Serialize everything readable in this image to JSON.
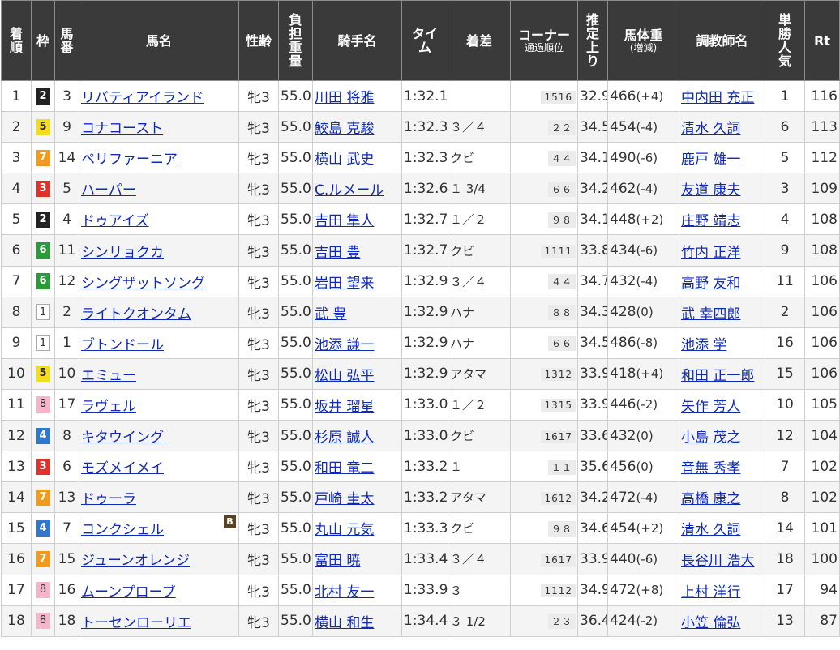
{
  "headers": {
    "rank": "着順",
    "waku": "枠",
    "num": "馬番",
    "horse": "馬名",
    "sexage": "性齢",
    "weight": "負担重量",
    "jockey": "騎手名",
    "time": "タイム",
    "margin": "着差",
    "corner_line1": "コーナー",
    "corner_line2": "通過順位",
    "last3f": "推定上り",
    "bodyweight_line1": "馬体重",
    "bodyweight_line2": "(増減)",
    "trainer": "調教師名",
    "pop": "単勝人気",
    "rt": "Rt"
  },
  "rows": [
    {
      "rank": "1",
      "waku": "2",
      "num": "3",
      "horse": "リバティアイランド",
      "blinker": "",
      "sexage": "牝3",
      "weight": "55.0",
      "jockey": "川田 将雅",
      "time": "1:32.1",
      "margin": "",
      "corner": "1516",
      "last3f": "32.9",
      "bw": "466",
      "bwdiff": "(+4)",
      "trainer": "中内田 充正",
      "pop": "1",
      "rt": "116"
    },
    {
      "rank": "2",
      "waku": "5",
      "num": "9",
      "horse": "コナコースト",
      "blinker": "",
      "sexage": "牝3",
      "weight": "55.0",
      "jockey": "鮫島 克駿",
      "time": "1:32.3",
      "margin": "３／４",
      "corner": "２２",
      "last3f": "34.5",
      "bw": "454",
      "bwdiff": "(-4)",
      "trainer": "清水 久詞",
      "pop": "6",
      "rt": "113"
    },
    {
      "rank": "3",
      "waku": "7",
      "num": "14",
      "horse": "ペリファーニア",
      "blinker": "",
      "sexage": "牝3",
      "weight": "55.0",
      "jockey": "横山 武史",
      "time": "1:32.3",
      "margin": "クビ",
      "corner": "４４",
      "last3f": "34.1",
      "bw": "490",
      "bwdiff": "(-6)",
      "trainer": "鹿戸 雄一",
      "pop": "5",
      "rt": "112"
    },
    {
      "rank": "4",
      "waku": "3",
      "num": "5",
      "horse": "ハーパー",
      "blinker": "",
      "sexage": "牝3",
      "weight": "55.0",
      "jockey": "C.ルメール",
      "time": "1:32.6",
      "margin": "１ 3/4",
      "corner": "６６",
      "last3f": "34.2",
      "bw": "462",
      "bwdiff": "(-4)",
      "trainer": "友道 康夫",
      "pop": "3",
      "rt": "109"
    },
    {
      "rank": "5",
      "waku": "2",
      "num": "4",
      "horse": "ドゥアイズ",
      "blinker": "",
      "sexage": "牝3",
      "weight": "55.0",
      "jockey": "吉田 隼人",
      "time": "1:32.7",
      "margin": "１／２",
      "corner": "９８",
      "last3f": "34.1",
      "bw": "448",
      "bwdiff": "(+2)",
      "trainer": "庄野 靖志",
      "pop": "4",
      "rt": "108"
    },
    {
      "rank": "6",
      "waku": "6",
      "num": "11",
      "horse": "シンリョクカ",
      "blinker": "",
      "sexage": "牝3",
      "weight": "55.0",
      "jockey": "吉田 豊",
      "time": "1:32.7",
      "margin": "クビ",
      "corner": "1111",
      "last3f": "33.8",
      "bw": "434",
      "bwdiff": "(-6)",
      "trainer": "竹内 正洋",
      "pop": "9",
      "rt": "108"
    },
    {
      "rank": "7",
      "waku": "6",
      "num": "12",
      "horse": "シングザットソング",
      "blinker": "",
      "sexage": "牝3",
      "weight": "55.0",
      "jockey": "岩田 望来",
      "time": "1:32.9",
      "margin": "３／４",
      "corner": "４４",
      "last3f": "34.7",
      "bw": "432",
      "bwdiff": "(-4)",
      "trainer": "高野 友和",
      "pop": "11",
      "rt": "106"
    },
    {
      "rank": "8",
      "waku": "1",
      "num": "2",
      "horse": "ライトクオンタム",
      "blinker": "",
      "sexage": "牝3",
      "weight": "55.0",
      "jockey": "武 豊",
      "time": "1:32.9",
      "margin": "ハナ",
      "corner": "８８",
      "last3f": "34.3",
      "bw": "428",
      "bwdiff": "(0)",
      "trainer": "武 幸四郎",
      "pop": "2",
      "rt": "106"
    },
    {
      "rank": "9",
      "waku": "1",
      "num": "1",
      "horse": "ブトンドール",
      "blinker": "",
      "sexage": "牝3",
      "weight": "55.0",
      "jockey": "池添 謙一",
      "time": "1:32.9",
      "margin": "ハナ",
      "corner": "６６",
      "last3f": "34.5",
      "bw": "486",
      "bwdiff": "(-8)",
      "trainer": "池添 学",
      "pop": "16",
      "rt": "106"
    },
    {
      "rank": "10",
      "waku": "5",
      "num": "10",
      "horse": "エミュー",
      "blinker": "",
      "sexage": "牝3",
      "weight": "55.0",
      "jockey": "松山 弘平",
      "time": "1:32.9",
      "margin": "アタマ",
      "corner": "1312",
      "last3f": "33.9",
      "bw": "418",
      "bwdiff": "(+4)",
      "trainer": "和田 正一郎",
      "pop": "15",
      "rt": "106"
    },
    {
      "rank": "11",
      "waku": "8",
      "num": "17",
      "horse": "ラヴェル",
      "blinker": "",
      "sexage": "牝3",
      "weight": "55.0",
      "jockey": "坂井 瑠星",
      "time": "1:33.0",
      "margin": "１／２",
      "corner": "1315",
      "last3f": "33.9",
      "bw": "446",
      "bwdiff": "(-2)",
      "trainer": "矢作 芳人",
      "pop": "10",
      "rt": "105"
    },
    {
      "rank": "12",
      "waku": "4",
      "num": "8",
      "horse": "キタウイング",
      "blinker": "",
      "sexage": "牝3",
      "weight": "55.0",
      "jockey": "杉原 誠人",
      "time": "1:33.0",
      "margin": "クビ",
      "corner": "1617",
      "last3f": "33.6",
      "bw": "432",
      "bwdiff": "(0)",
      "trainer": "小島 茂之",
      "pop": "12",
      "rt": "104"
    },
    {
      "rank": "13",
      "waku": "3",
      "num": "6",
      "horse": "モズメイメイ",
      "blinker": "",
      "sexage": "牝3",
      "weight": "55.0",
      "jockey": "和田 竜二",
      "time": "1:33.2",
      "margin": "１",
      "corner": "１１",
      "last3f": "35.6",
      "bw": "456",
      "bwdiff": "(0)",
      "trainer": "音無 秀孝",
      "pop": "7",
      "rt": "102"
    },
    {
      "rank": "14",
      "waku": "7",
      "num": "13",
      "horse": "ドゥーラ",
      "blinker": "",
      "sexage": "牝3",
      "weight": "55.0",
      "jockey": "戸崎 圭太",
      "time": "1:33.2",
      "margin": "アタマ",
      "corner": "1612",
      "last3f": "34.2",
      "bw": "472",
      "bwdiff": "(-4)",
      "trainer": "高橋 康之",
      "pop": "8",
      "rt": "102"
    },
    {
      "rank": "15",
      "waku": "4",
      "num": "7",
      "horse": "コンクシェル",
      "blinker": "B",
      "sexage": "牝3",
      "weight": "55.0",
      "jockey": "丸山 元気",
      "time": "1:33.3",
      "margin": "クビ",
      "corner": "９８",
      "last3f": "34.6",
      "bw": "454",
      "bwdiff": "(+2)",
      "trainer": "清水 久詞",
      "pop": "14",
      "rt": "101"
    },
    {
      "rank": "16",
      "waku": "7",
      "num": "15",
      "horse": "ジューンオレンジ",
      "blinker": "",
      "sexage": "牝3",
      "weight": "55.0",
      "jockey": "富田 暁",
      "time": "1:33.4",
      "margin": "３／４",
      "corner": "1617",
      "last3f": "33.9",
      "bw": "440",
      "bwdiff": "(-6)",
      "trainer": "長谷川 浩大",
      "pop": "18",
      "rt": "100"
    },
    {
      "rank": "17",
      "waku": "8",
      "num": "16",
      "horse": "ムーンプローブ",
      "blinker": "",
      "sexage": "牝3",
      "weight": "55.0",
      "jockey": "北村 友一",
      "time": "1:33.9",
      "margin": "３",
      "corner": "1112",
      "last3f": "34.9",
      "bw": "472",
      "bwdiff": "(+8)",
      "trainer": "上村 洋行",
      "pop": "17",
      "rt": "94"
    },
    {
      "rank": "18",
      "waku": "8",
      "num": "18",
      "horse": "トーセンローリエ",
      "blinker": "",
      "sexage": "牝3",
      "weight": "55.0",
      "jockey": "横山 和生",
      "time": "1:34.4",
      "margin": "３ 1/2",
      "corner": "２３",
      "last3f": "36.4",
      "bw": "424",
      "bwdiff": "(-2)",
      "trainer": "小笠 倫弘",
      "pop": "13",
      "rt": "87"
    }
  ]
}
